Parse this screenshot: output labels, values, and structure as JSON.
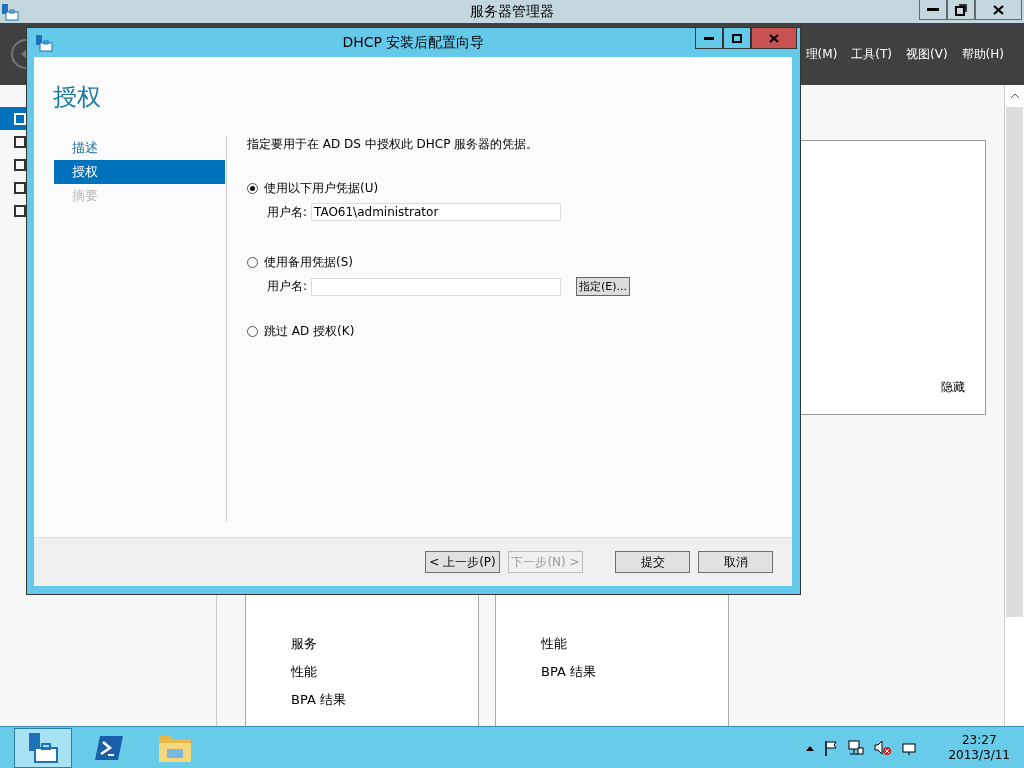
{
  "app_window": {
    "title": "服务器管理器",
    "menu": [
      "理(M)",
      "工具(T)",
      "视图(V)",
      "帮助(H)"
    ],
    "sidebar_items": [
      {
        "selected": true
      },
      {
        "selected": false
      },
      {
        "selected": false
      },
      {
        "selected": false
      },
      {
        "selected": false
      }
    ],
    "hide_link": "隐藏",
    "tiles": [
      {
        "items": [
          "服务",
          "性能",
          "BPA 结果"
        ]
      },
      {
        "items": [
          "性能",
          "BPA 结果"
        ]
      }
    ]
  },
  "dialog": {
    "title": "DHCP 安装后配置向导",
    "heading": "授权",
    "steps": [
      {
        "label": "描述",
        "selected": false,
        "disabled": false
      },
      {
        "label": "授权",
        "selected": true,
        "disabled": false
      },
      {
        "label": "摘要",
        "selected": false,
        "disabled": true
      }
    ],
    "instruction": "指定要用于在 AD DS 中授权此 DHCP 服务器的凭据。",
    "options": [
      {
        "label": "使用以下用户凭据(U)",
        "selected": true,
        "field": {
          "label": "用户名:",
          "value": "TAO61\\administrator"
        }
      },
      {
        "label": "使用备用凭据(S)",
        "selected": false,
        "field": {
          "label": "用户名:"
        },
        "button": "指定(E)..."
      },
      {
        "label": "跳过 AD 授权(K)",
        "selected": false
      }
    ],
    "buttons": [
      {
        "label": "< 上一步(P)",
        "disabled": false
      },
      {
        "label": "下一步(N) >",
        "disabled": true
      },
      {
        "label": "提交",
        "disabled": false
      },
      {
        "label": "取消",
        "disabled": false
      }
    ]
  },
  "taskbar": {
    "apps": [
      {
        "kind": "server",
        "selected": true
      },
      {
        "kind": "shell",
        "selected": false
      },
      {
        "kind": "folder",
        "selected": false
      }
    ],
    "time": "23:27",
    "date": "2013/3/11"
  }
}
